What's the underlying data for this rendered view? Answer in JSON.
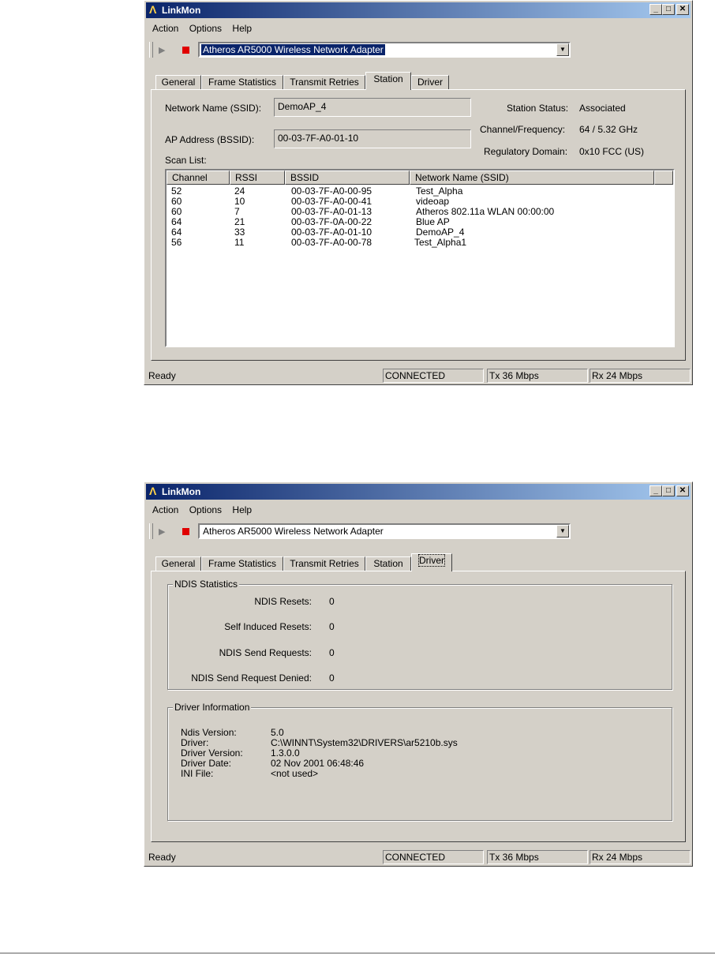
{
  "window1": {
    "title": "LinkMon",
    "menu": [
      "Action",
      "Options",
      "Help"
    ],
    "adapter": "Atheros AR5000 Wireless Network Adapter",
    "tabs": [
      "General",
      "Frame Statistics",
      "Transmit Retries",
      "Station",
      "Driver"
    ],
    "active_tab": "Station",
    "station": {
      "ssid_label": "Network Name (SSID):",
      "ssid_value": "DemoAP_4",
      "bssid_label": "AP Address (BSSID):",
      "bssid_value": "00-03-7F-A0-01-10",
      "status_label": "Station Status:",
      "status_value": "Associated",
      "channel_label": "Channel/Frequency:",
      "channel_value": "64 / 5.32 GHz",
      "regdomain_label": "Regulatory Domain:",
      "regdomain_value": "0x10 FCC (US)",
      "scanlist_label": "Scan List:",
      "columns": [
        "Channel",
        "RSSI",
        "BSSID",
        "Network Name (SSID)"
      ],
      "rows": [
        [
          "52",
          "24",
          "00-03-7F-A0-00-95",
          "Test_Alpha"
        ],
        [
          "60",
          "10",
          "00-03-7F-A0-00-41",
          "videoap"
        ],
        [
          "60",
          "7",
          "00-03-7F-A0-01-13",
          "Atheros 802.11a WLAN 00:00:00"
        ],
        [
          "64",
          "21",
          "00-03-7F-0A-00-22",
          "Blue AP"
        ],
        [
          "64",
          "33",
          "00-03-7F-A0-01-10",
          "DemoAP_4"
        ],
        [
          "56",
          "11",
          "00-03-7F-A0-00-78",
          "Test_Alpha1"
        ]
      ]
    },
    "status": [
      "Ready",
      "CONNECTED",
      "Tx 36 Mbps",
      "Rx 24 Mbps"
    ]
  },
  "window2": {
    "title": "LinkMon",
    "menu": [
      "Action",
      "Options",
      "Help"
    ],
    "adapter": "Atheros AR5000 Wireless Network Adapter",
    "tabs": [
      "General",
      "Frame Statistics",
      "Transmit Retries",
      "Station",
      "Driver"
    ],
    "active_tab": "Driver",
    "ndis": {
      "group_title": "NDIS Statistics",
      "items": [
        {
          "label": "NDIS Resets:",
          "value": "0"
        },
        {
          "label": "Self Induced Resets:",
          "value": "0"
        },
        {
          "label": "NDIS Send Requests:",
          "value": "0"
        },
        {
          "label": "NDIS Send Request Denied:",
          "value": "0"
        }
      ]
    },
    "driver_info": {
      "group_title": "Driver Information",
      "items": [
        {
          "label": "Ndis Version:",
          "value": "5.0"
        },
        {
          "label": "Driver:",
          "value": "C:\\WINNT\\System32\\DRIVERS\\ar5210b.sys"
        },
        {
          "label": "Driver Version:",
          "value": "1.3.0.0"
        },
        {
          "label": "Driver Date:",
          "value": "02 Nov 2001 06:48:46"
        },
        {
          "label": "INI File:",
          "value": "<not used>"
        }
      ]
    },
    "status": [
      "Ready",
      "CONNECTED",
      "Tx 36 Mbps",
      "Rx 24 Mbps"
    ]
  }
}
